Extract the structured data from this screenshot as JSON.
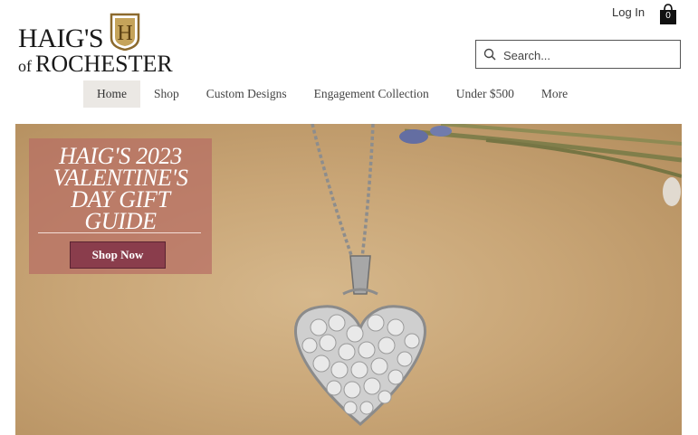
{
  "brand": {
    "name_line1": "HAIG'S",
    "name_of": "of",
    "name_line2": "ROCHESTER",
    "emblem_letter": "H"
  },
  "header": {
    "login_label": "Log In",
    "cart_count": "0",
    "search_placeholder": "Search..."
  },
  "nav": {
    "items": [
      {
        "label": "Home",
        "active": true
      },
      {
        "label": "Shop"
      },
      {
        "label": "Custom Designs"
      },
      {
        "label": "Engagement Collection"
      },
      {
        "label": "Under $500"
      },
      {
        "label": "More"
      }
    ]
  },
  "hero": {
    "headline": "HAIG'S 2023 VALENTINE'S DAY GIFT GUIDE",
    "cta_label": "Shop Now"
  },
  "colors": {
    "promo_bg": "#b76e64",
    "cta_bg": "#8a3d4c",
    "active_nav_bg": "#ebe8e4"
  }
}
